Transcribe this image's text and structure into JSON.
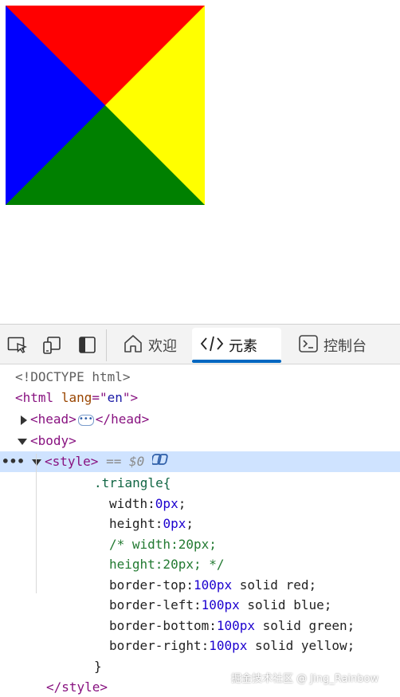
{
  "devtools": {
    "tabs": [
      {
        "label": "欢迎",
        "icon": "home-icon"
      },
      {
        "label": "元素",
        "icon": "code-brackets-icon"
      },
      {
        "label": "控制台",
        "icon": "console-icon"
      }
    ],
    "active_tab": "元素",
    "toolbar_icons": [
      "inspect-element-icon",
      "device-emulation-icon",
      "dock-side-icon"
    ]
  },
  "rendered_page": {
    "triangle_colors": {
      "top": "#ff0000",
      "left": "#0000ff",
      "bottom": "#008000",
      "right": "#ffff00"
    }
  },
  "tree": {
    "doctype": "<!DOCTYPE html>",
    "html_open": "<html",
    "html_attr_name": "lang",
    "html_attr_eq": "=\"",
    "html_attr_value": "en",
    "html_attr_close": "\">",
    "head_open": "<head>",
    "head_close": "</head>",
    "body_open": "<body>",
    "style_open": "<style>",
    "style_ref": "== $0",
    "css": {
      "selector": ".triangle{",
      "width_prop": "width:",
      "width_num": "0px",
      "height_prop": "height:",
      "height_num": "0px",
      "comment_line1": "/* width:20px;",
      "comment_line2": "height:20px; */",
      "border_top_prop": "border-top:",
      "border_top_num": "100px",
      "border_top_val": " solid red;",
      "border_left_prop": "border-left:",
      "border_left_num": "100px",
      "border_left_val": " solid blue;",
      "border_bottom_prop": "border-bottom:",
      "border_bottom_num": "100px",
      "border_bottom_val": " solid green;",
      "border_right_prop": "border-right:",
      "border_right_num": "100px",
      "border_right_val": " solid yellow;",
      "close_brace": "}"
    },
    "style_close": "</style>",
    "semi": ";",
    "ellipsis": "•••"
  },
  "watermark": "掘金技术社区 @ Jing_Rainbow"
}
